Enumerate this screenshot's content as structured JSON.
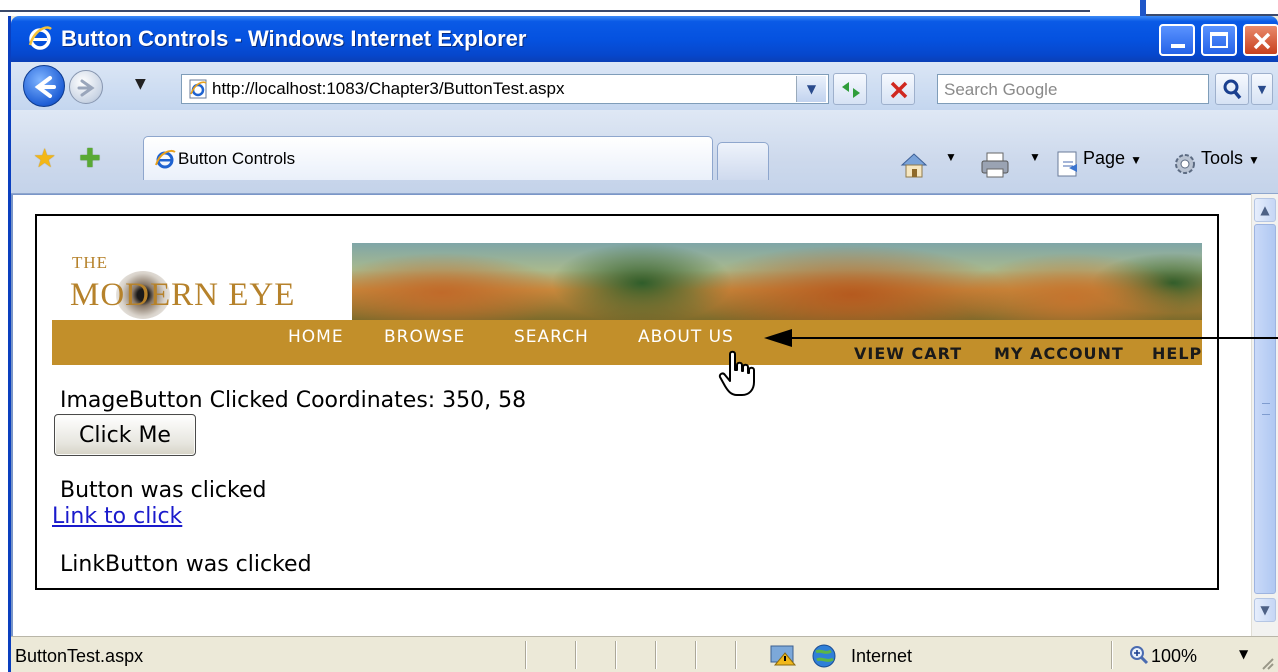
{
  "window": {
    "title": "Button Controls - Windows Internet Explorer"
  },
  "address_bar": {
    "url": "http://localhost:1083/Chapter3/ButtonTest.aspx"
  },
  "search": {
    "placeholder": "Search Google"
  },
  "tab": {
    "label": "Button Controls"
  },
  "toolbar": {
    "page_label": "Page",
    "tools_label": "Tools"
  },
  "banner": {
    "logo_the": "THE",
    "logo_name": "MODERN EYE",
    "nav": [
      "HOME",
      "BROWSE",
      "SEARCH",
      "ABOUT US"
    ],
    "nav_right": [
      "VIEW CART",
      "MY ACCOUNT",
      "HELP"
    ]
  },
  "content": {
    "image_button_result": "ImageButton Clicked Coordinates: 350, 58",
    "button_label": "Click Me",
    "button_result": "Button was clicked",
    "link_label": "Link to click",
    "link_result": "LinkButton was clicked"
  },
  "status": {
    "text": "ButtonTest.aspx",
    "zone": "Internet",
    "zoom": "100%"
  },
  "colors": {
    "nav_bar": "#c28f2a",
    "title_bar": "#0552e0",
    "link": "#1a1acc"
  }
}
